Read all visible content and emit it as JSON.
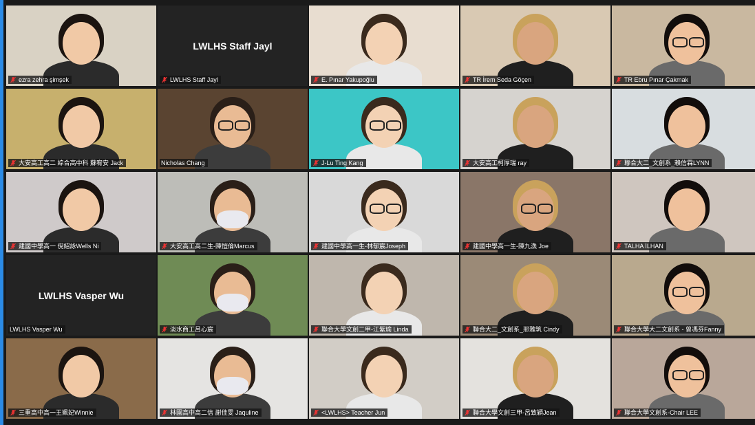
{
  "participants": [
    {
      "name": "ezra zehra şimşek",
      "muted": true,
      "active": true,
      "video": true,
      "bg": "#d9d2c4"
    },
    {
      "name": "LWLHS Staff Jayl",
      "display_name": "LWLHS Staff Jayl",
      "muted": true,
      "video": false
    },
    {
      "name": "E. Pınar Yakupoğlu",
      "muted": true,
      "video": true,
      "bg": "#e8ddd0"
    },
    {
      "name": "TR İrem Seda Göçen",
      "muted": true,
      "video": true,
      "bg": "#d9c9b3"
    },
    {
      "name": "TR Ebru Pınar Çakmak",
      "muted": true,
      "video": true,
      "bg": "#c9b8a0"
    },
    {
      "name": "大安高工高二 綜合高中科 蘇宥安 Jack",
      "muted": true,
      "video": true,
      "bg": "#c7b06d"
    },
    {
      "name": "Nicholas Chang",
      "muted": false,
      "video": true,
      "bg": "#5a4431"
    },
    {
      "name": "J-Lu Ting Kang",
      "muted": true,
      "video": true,
      "bg": "#3cc6c6"
    },
    {
      "name": "大安高工柯厚瑞 ray",
      "muted": true,
      "video": true,
      "bg": "#d6d3cf"
    },
    {
      "name": "聯合大二_文創系_賴信霖LYNN",
      "muted": true,
      "video": true,
      "bg": "#d8dde0"
    },
    {
      "name": "建國中學高一 倪紹詠Wells Ni",
      "muted": true,
      "video": true,
      "bg": "#cfcaca"
    },
    {
      "name": "大安高工高二生-陳愷倫Marcus",
      "muted": true,
      "video": true,
      "bg": "#bdbdb8"
    },
    {
      "name": "建國中學高一生-林郁宸Joseph",
      "muted": true,
      "video": true,
      "bg": "#d9d9d9"
    },
    {
      "name": "建國中學高一生-陳九漁 Joe",
      "muted": true,
      "video": true,
      "bg": "#8a7668"
    },
    {
      "name": "TALHA İLHAN",
      "muted": true,
      "video": true,
      "bg": "#cfc6bf"
    },
    {
      "name": "LWLHS Vasper Wu",
      "display_name": "LWLHS Vasper Wu",
      "muted": false,
      "video": false
    },
    {
      "name": "淡水商工呂心宸",
      "muted": true,
      "video": true,
      "bg": "#6f8b55"
    },
    {
      "name": "聯合大學文創二甲-江紫瑜 Linda",
      "muted": true,
      "video": true,
      "bg": "#bfb7ad"
    },
    {
      "name": "聯合大二_文創系_邢雅筑 Cindy",
      "muted": true,
      "video": true,
      "bg": "#9b8a77"
    },
    {
      "name": "聯合大學大二文創系 - 曾馮芬Fanny",
      "muted": true,
      "video": true,
      "bg": "#b9a98e"
    },
    {
      "name": "三重高中高一王姵妃Winnie",
      "muted": true,
      "video": true,
      "bg": "#8a6b4a"
    },
    {
      "name": "林園高中高二信 謝佳雯 Jaquline",
      "muted": true,
      "video": true,
      "bg": "#e5e4e2"
    },
    {
      "name": "<LWLHS> Teacher Jun",
      "muted": true,
      "video": true,
      "bg": "#d2cdc6"
    },
    {
      "name": "聯合大學文創三甲-呂致穎Jean",
      "muted": true,
      "video": true,
      "bg": "#e4e2de"
    },
    {
      "name": "聯合大學文創系-Chair LEE",
      "muted": true,
      "video": true,
      "bg": "#b9a79a"
    }
  ]
}
